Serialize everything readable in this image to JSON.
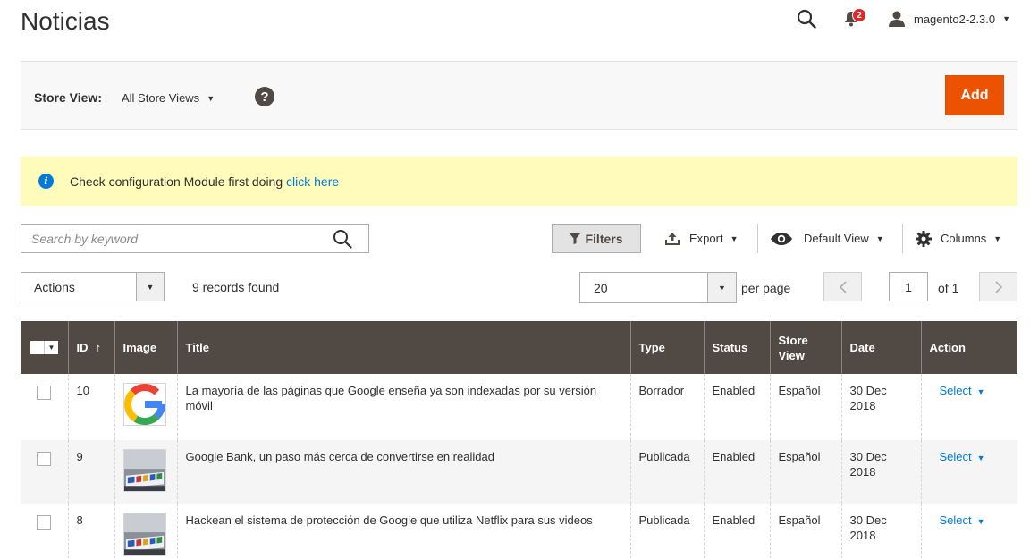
{
  "page": {
    "title": "Noticias"
  },
  "header": {
    "notifications_count": "2",
    "username": "magento2-2.3.0"
  },
  "store_switcher": {
    "label": "Store View:",
    "selected": "All Store Views",
    "help_glyph": "?",
    "add_label": "Add"
  },
  "notice": {
    "text": "Check configuration Module first doing ",
    "link_text": "click here"
  },
  "toolbar": {
    "search_placeholder": "Search by keyword",
    "filters_label": "Filters",
    "export_label": "Export",
    "view_label": "Default View",
    "columns_label": "Columns",
    "actions_label": "Actions",
    "records_found": "9 records found",
    "per_page_value": "20",
    "per_page_label": "per page",
    "page_current": "1",
    "page_of": "of 1"
  },
  "grid": {
    "columns": [
      "ID",
      "Image",
      "Title",
      "Type",
      "Status",
      "Store View",
      "Date",
      "Action"
    ],
    "sort_glyph": "↑",
    "rows": [
      {
        "id": "10",
        "image": "google-logo",
        "title": "La mayoría de las páginas que Google enseña ya son indexadas por su versión móvil",
        "type": "Borrador",
        "status": "Enabled",
        "store_view": "Español",
        "date": "30 Dec 2018",
        "action": "Select"
      },
      {
        "id": "9",
        "image": "google-sign-photo",
        "title": "Google Bank, un paso más cerca de convertirse en realidad",
        "type": "Publicada",
        "status": "Enabled",
        "store_view": "Español",
        "date": "30 Dec 2018",
        "action": "Select"
      },
      {
        "id": "8",
        "image": "google-sign-photo",
        "title": "Hackean el sistema de protección de Google que utiliza Netflix para sus videos",
        "type": "Publicada",
        "status": "Enabled",
        "store_view": "Español",
        "date": "30 Dec 2018",
        "action": "Select"
      }
    ]
  },
  "colors": {
    "accent": "#eb5202",
    "header_bg": "#514943",
    "link": "#007bdb",
    "notice_bg": "#fffbbb",
    "badge": "#e22626"
  }
}
